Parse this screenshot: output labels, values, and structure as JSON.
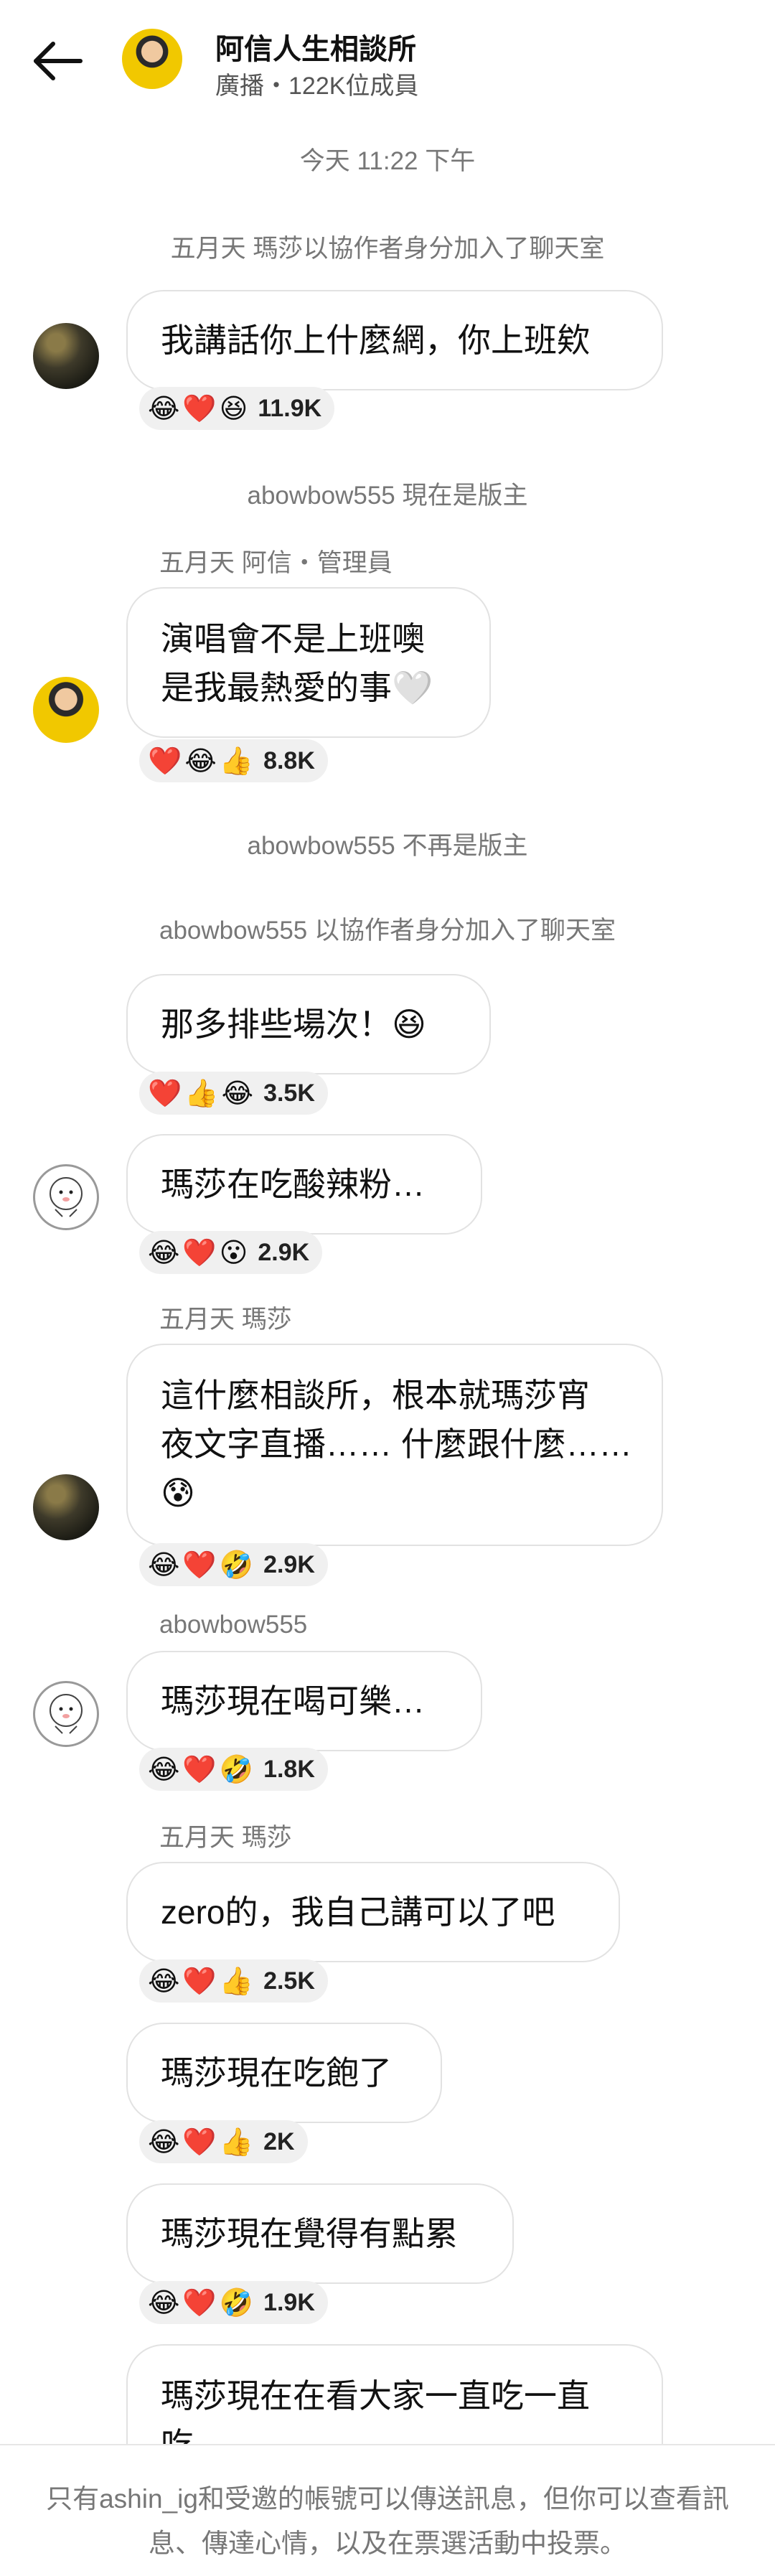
{
  "header": {
    "title": "阿信人生相談所",
    "subtitle": "廣播・122K位成員"
  },
  "messages": {
    "timestamp": "今天 11:22 下午",
    "sys1": "五月天 瑪莎以協作者身分加入了聊天室",
    "m1": {
      "lines": [
        "我講話你上什麼網，你上班欸"
      ],
      "reactions": [
        "😂",
        "❤️",
        "😆"
      ],
      "count": "11.9K"
    },
    "sys2": "abowbow555 現在是版主",
    "sender2": "五月天 阿信・管理員",
    "m2": {
      "lines": [
        "演唱會不是上班噢",
        "是我最熱愛的事🤍"
      ],
      "reactions": [
        "❤️",
        "😂",
        "👍"
      ],
      "count": "8.8K"
    },
    "sys3": "abowbow555 不再是版主",
    "sys4": "abowbow555 以協作者身分加入了聊天室",
    "m3": {
      "lines": [
        "那多排些場次！😆"
      ],
      "reactions": [
        "❤️",
        "👍",
        "😂"
      ],
      "count": "3.5K"
    },
    "m4": {
      "lines": [
        "瑪莎在吃酸辣粉…"
      ],
      "reactions": [
        "😂",
        "❤️",
        "😮"
      ],
      "count": "2.9K"
    },
    "sender5": "五月天 瑪莎",
    "m5": {
      "lines": [
        "這什麼相談所，根本就瑪莎宵",
        "夜文字直播…… 什麼跟什麼……",
        "😰"
      ],
      "reactions": [
        "😂",
        "❤️",
        "🤣"
      ],
      "count": "2.9K"
    },
    "sender6": "abowbow555",
    "m6": {
      "lines": [
        "瑪莎現在喝可樂…"
      ],
      "reactions": [
        "😂",
        "❤️",
        "🤣"
      ],
      "count": "1.8K"
    },
    "sender7": "五月天 瑪莎",
    "m7": {
      "lines": [
        "zero的，我自己講可以了吧"
      ],
      "reactions": [
        "😂",
        "❤️",
        "👍"
      ],
      "count": "2.5K"
    },
    "m8": {
      "lines": [
        "瑪莎現在吃飽了"
      ],
      "reactions": [
        "😂",
        "❤️",
        "👍"
      ],
      "count": "2K"
    },
    "m9": {
      "lines": [
        "瑪莎現在覺得有點累"
      ],
      "reactions": [
        "😂",
        "❤️",
        "🤣"
      ],
      "count": "1.9K"
    },
    "m10": {
      "lines": [
        "瑪莎現在在看大家一直吃一直",
        "吃"
      ]
    }
  },
  "footer": {
    "line1": "只有ashin_ig和受邀的帳號可以傳送訊息，但你可以查看訊",
    "line2": "息、傳達心情，以及在票選活動中投票。"
  },
  "colors": {
    "text": "#111111",
    "muted": "#777777",
    "bubble_border": "#e2e2e2",
    "reaction_bg": "#f0f0f0",
    "avatar_yellow": "#f1c800"
  },
  "icons": [
    "back-arrow-icon"
  ]
}
